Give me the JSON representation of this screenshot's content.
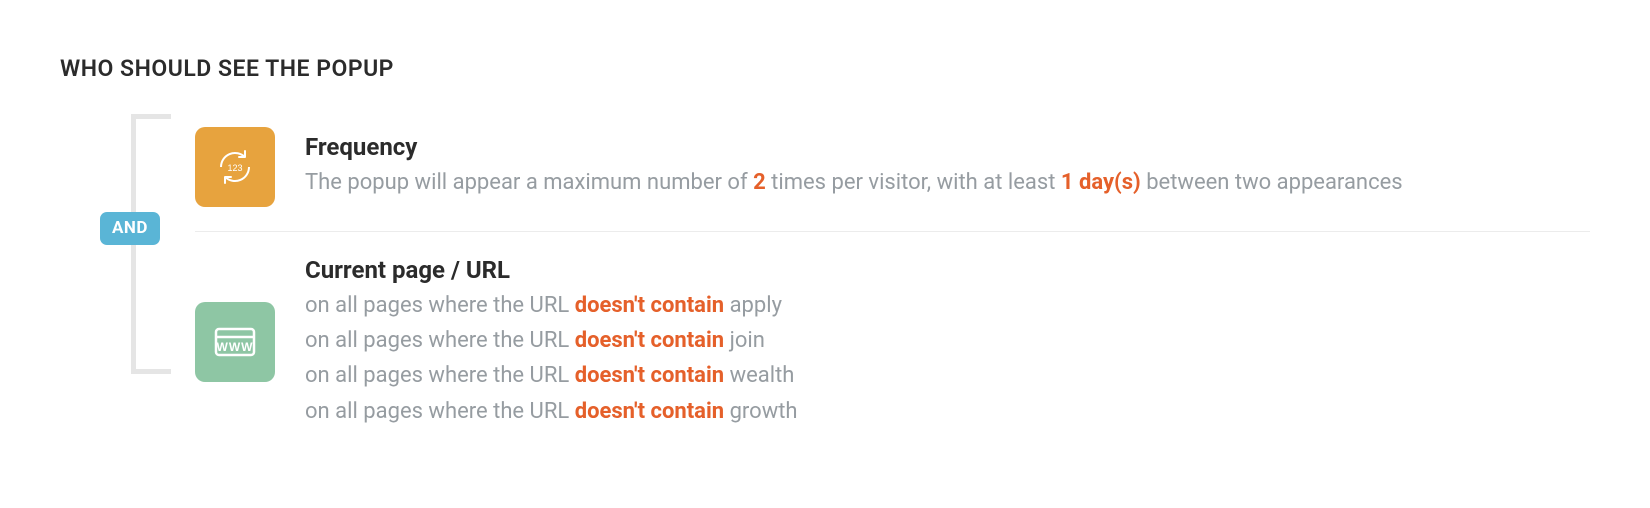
{
  "section_title": "WHO SHOULD SEE THE POPUP",
  "connector_label": "AND",
  "rules": {
    "frequency": {
      "title": "Frequency",
      "sentence_prefix": "The popup will appear a maximum number of ",
      "max_times_value": "2",
      "sentence_mid": " times per visitor, with at least ",
      "interval_value": "1 day(s)",
      "sentence_suffix": " between two appearances"
    },
    "url": {
      "title": "Current page / URL",
      "lines": [
        {
          "prefix": "on all pages where the URL ",
          "operator": "doesn't contain",
          "value": " apply"
        },
        {
          "prefix": "on all pages where the URL ",
          "operator": "doesn't contain",
          "value": " join"
        },
        {
          "prefix": "on all pages where the URL ",
          "operator": "doesn't contain",
          "value": " wealth"
        },
        {
          "prefix": "on all pages where the URL ",
          "operator": "doesn't contain",
          "value": " growth"
        }
      ]
    }
  }
}
